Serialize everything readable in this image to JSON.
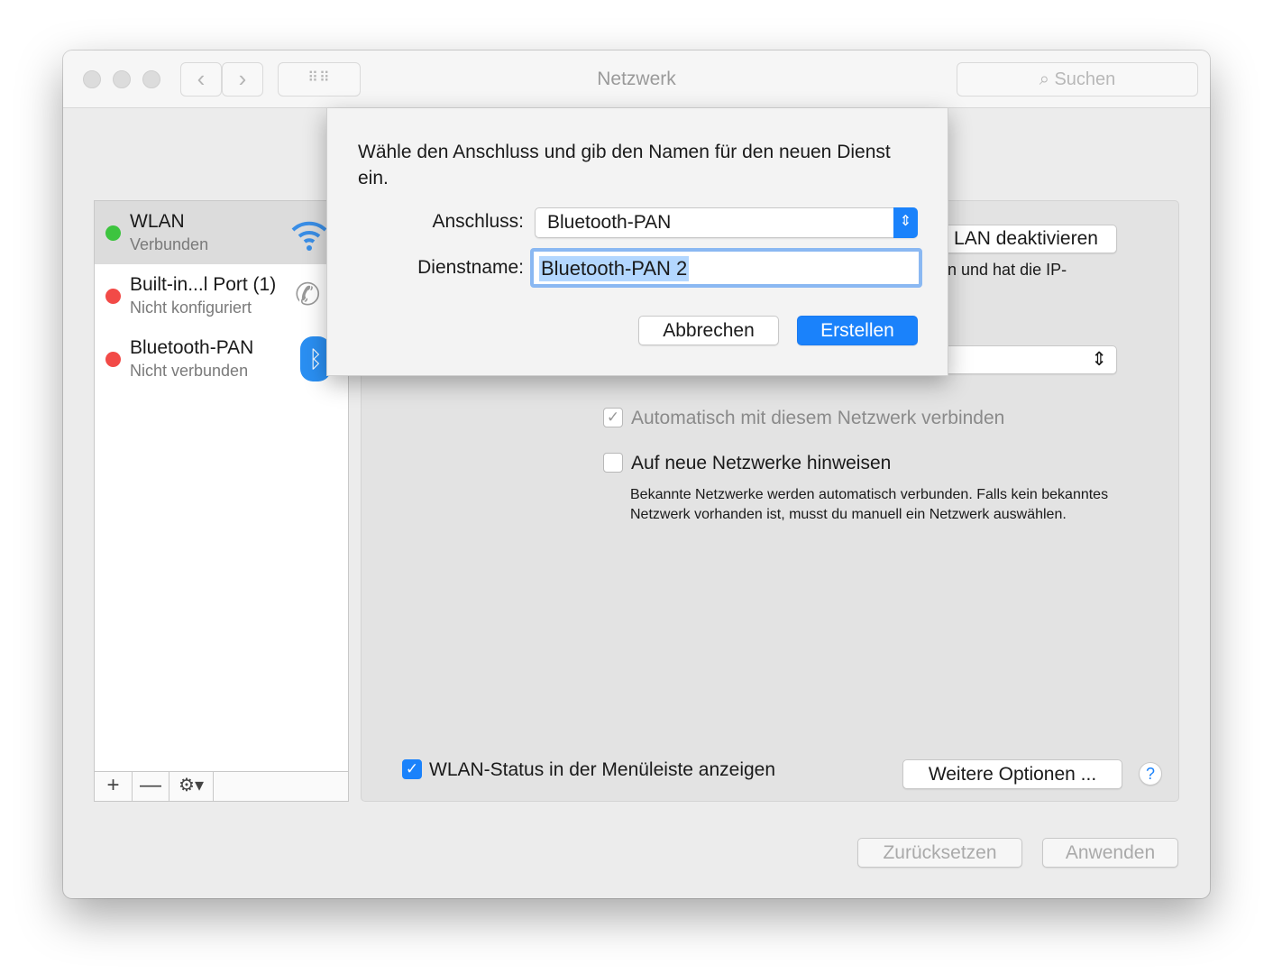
{
  "window": {
    "title": "Netzwerk",
    "search_placeholder": "Suchen"
  },
  "services": [
    {
      "name": "WLAN",
      "status": "Verbunden",
      "dot": "#3dc43f",
      "icon": "wifi-icon"
    },
    {
      "name": "Built-in...l Port (1)",
      "status": "Nicht konfiguriert",
      "dot": "#f24a47",
      "icon": "phone-icon"
    },
    {
      "name": "Bluetooth-PAN",
      "status": "Nicht verbunden",
      "dot": "#f24a47",
      "icon": "bluetooth-icon"
    }
  ],
  "list_toolbar": {
    "add": "+",
    "remove": "—"
  },
  "panel": {
    "toggle_button": "LAN deaktivieren",
    "status_fragment": "n und hat die IP-",
    "auto_connect": "Automatisch mit diesem Netzwerk verbinden",
    "ask_new": "Auf neue Netzwerke hinweisen",
    "ask_new_help": "Bekannte Netzwerke werden automatisch verbunden. Falls kein bekanntes Netzwerk vorhanden ist, musst du manuell ein Netzwerk auswählen.",
    "show_status": "WLAN-Status in der Menüleiste anzeigen",
    "more_options": "Weitere Optionen ...",
    "help": "?"
  },
  "footer": {
    "revert": "Zurücksetzen",
    "apply": "Anwenden"
  },
  "sheet": {
    "message": "Wähle den Anschluss und gib den Namen für den neuen Dienst ein.",
    "interface_label": "Anschluss:",
    "interface_value": "Bluetooth-PAN",
    "service_label": "Dienstname:",
    "service_value": "Bluetooth-PAN 2",
    "cancel": "Abbrechen",
    "create": "Erstellen"
  },
  "colors": {
    "accent": "#1a82fb"
  }
}
